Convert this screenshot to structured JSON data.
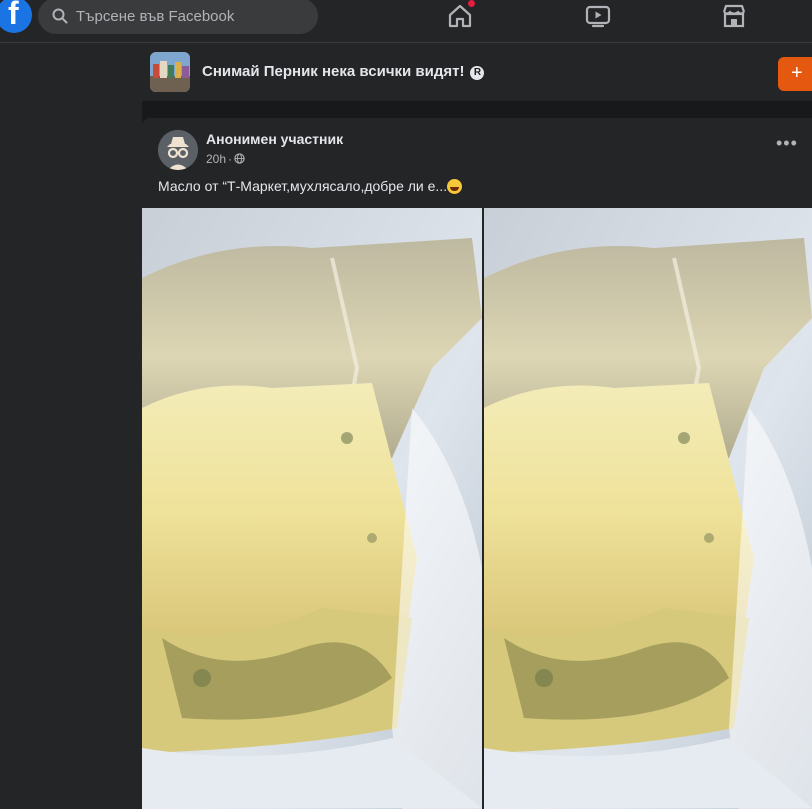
{
  "topbar": {
    "search_placeholder": "Търсене във Facebook",
    "logo_letter": "f",
    "nav_items": [
      "home-icon",
      "watch-icon",
      "marketplace-icon"
    ]
  },
  "group": {
    "title": "Снимай Перник нека всички видят!",
    "badge": "R",
    "join_label": "+"
  },
  "post": {
    "author": "Анонимен участник",
    "time": "20h",
    "separator": "·",
    "privacy_icon": "globe-icon",
    "text": "Масло от “Т-Маркет,мухлясало,добре ли е...",
    "emoji": "grinning-face-emoji",
    "more": "•••"
  },
  "colors": {
    "background": "#18191a",
    "surface": "#242526",
    "brand": "#1b74e4",
    "accent": "#e4580f",
    "text": "#e4e6eb",
    "muted": "#b0b3b8"
  }
}
